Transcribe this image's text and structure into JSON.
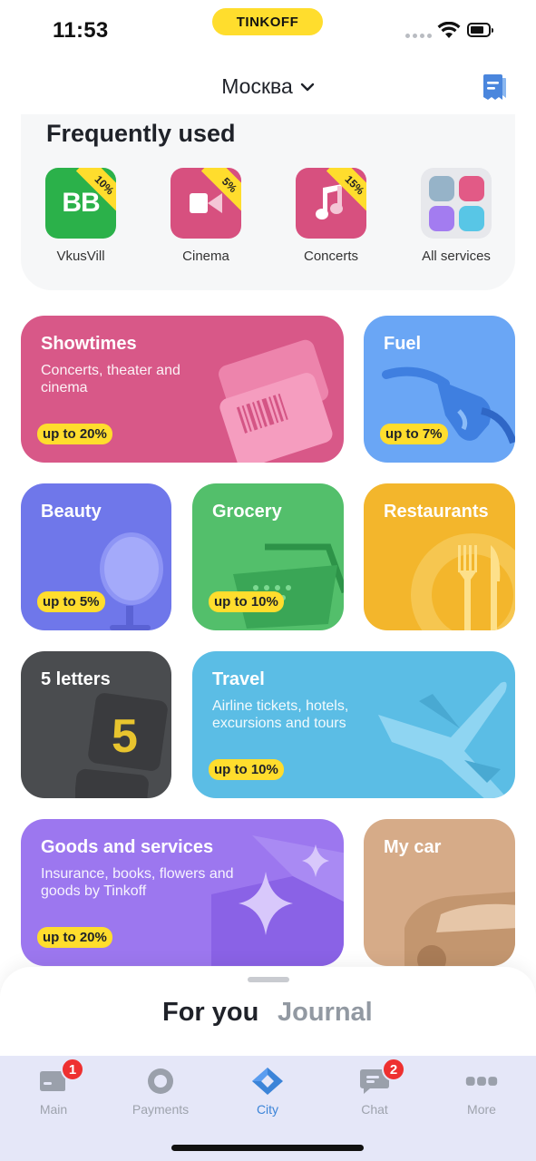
{
  "status_bar": {
    "time": "11:53",
    "carrier": "TINKOFF"
  },
  "header": {
    "city": "Москва"
  },
  "frequently_used": {
    "title": "Frequently used",
    "items": [
      {
        "label": "VkusVill",
        "icon_text": "BB",
        "discount": "10%",
        "icon": "vkusvill-logo",
        "color": "#2bb14a"
      },
      {
        "label": "Cinema",
        "discount": "5%",
        "icon": "camera-icon",
        "color": "#d7507f"
      },
      {
        "label": "Concerts",
        "discount": "15%",
        "icon": "music-note-icon",
        "color": "#d7507f"
      },
      {
        "label": "All services",
        "icon": "grid-icon",
        "tile_colors": [
          "#96b3c8",
          "#e25a86",
          "#a37cf0",
          "#58c6e6"
        ]
      }
    ]
  },
  "tiles": [
    {
      "title": "Showtimes",
      "subtitle": "Concerts, theater and cinema",
      "badge": "up to 20%",
      "color": "#d85888"
    },
    {
      "title": "Fuel",
      "badge": "up to 7%",
      "color": "#6aa6f5"
    },
    {
      "title": "Beauty",
      "badge": "up to 5%",
      "color": "#6f77ea"
    },
    {
      "title": "Grocery",
      "badge": "up to 10%",
      "color": "#53bf6b"
    },
    {
      "title": "Restaurants",
      "color": "#f3b62c"
    },
    {
      "title": "5 letters",
      "color": "#4a4c4f",
      "deco_digit": "5"
    },
    {
      "title": "Travel",
      "subtitle": "Airline tickets, hotels, excursions and tours",
      "badge": "up to 10%",
      "color": "#5bbde5"
    },
    {
      "title": "Goods and services",
      "subtitle": "Insurance, books, flowers and goods by Tinkoff",
      "badge": "up to 20%",
      "color": "#9c77ef"
    },
    {
      "title": "My car",
      "color": "#d6ab88"
    }
  ],
  "sheet": {
    "tabs": [
      "For you",
      "Journal"
    ],
    "active": "For you"
  },
  "tabbar": {
    "items": [
      {
        "label": "Main",
        "badge": "1",
        "icon": "card-icon"
      },
      {
        "label": "Payments",
        "icon": "circle-icon"
      },
      {
        "label": "City",
        "icon": "city-diamond-icon",
        "active": true
      },
      {
        "label": "Chat",
        "badge": "2",
        "icon": "chat-icon"
      },
      {
        "label": "More",
        "icon": "more-icon"
      }
    ]
  },
  "colors": {
    "accent": "#ffdd2d",
    "active_tab": "#3b84d8",
    "badge_red": "#ee3030"
  }
}
